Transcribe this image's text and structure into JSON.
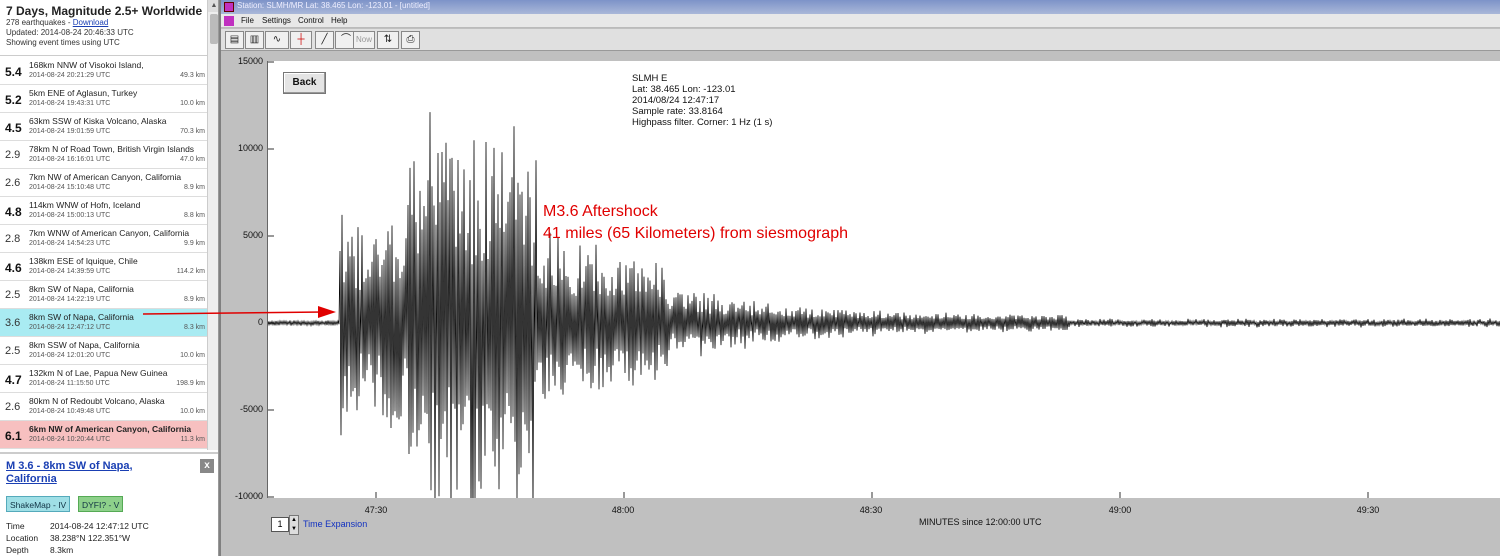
{
  "feed": {
    "title": "7 Days, Magnitude 2.5+ Worldwide",
    "count_text": "278 earthquakes - ",
    "download_label": "Download",
    "updated": "Updated: 2014-08-24 20:46:33 UTC",
    "showing": "Showing event times using UTC"
  },
  "quakes": [
    {
      "mag": "5.4",
      "place": "168km NNW of Visokoi Island,",
      "time": "2014-08-24 20:21:29 UTC",
      "depth": "49.3 km"
    },
    {
      "mag": "5.2",
      "place": "5km ENE of Aglasun, Turkey",
      "time": "2014-08-24 19:43:31 UTC",
      "depth": "10.0 km"
    },
    {
      "mag": "4.5",
      "place": "63km SSW of Kiska Volcano, Alaska",
      "time": "2014-08-24 19:01:59 UTC",
      "depth": "70.3 km"
    },
    {
      "mag": "2.9",
      "place": "78km N of Road Town, British Virgin Islands",
      "time": "2014-08-24 16:16:01 UTC",
      "depth": "47.0 km"
    },
    {
      "mag": "2.6",
      "place": "7km NW of American Canyon, California",
      "time": "2014-08-24 15:10:48 UTC",
      "depth": "8.9 km"
    },
    {
      "mag": "4.8",
      "place": "114km WNW of Hofn, Iceland",
      "time": "2014-08-24 15:00:13 UTC",
      "depth": "8.8 km"
    },
    {
      "mag": "2.8",
      "place": "7km WNW of American Canyon, California",
      "time": "2014-08-24 14:54:23 UTC",
      "depth": "9.9 km"
    },
    {
      "mag": "4.6",
      "place": "138km ESE of Iquique, Chile",
      "time": "2014-08-24 14:39:59 UTC",
      "depth": "114.2 km"
    },
    {
      "mag": "2.5",
      "place": "8km SW of Napa, California",
      "time": "2014-08-24 14:22:19 UTC",
      "depth": "8.9 km"
    },
    {
      "mag": "3.6",
      "place": "8km SW of Napa, California",
      "time": "2014-08-24 12:47:12 UTC",
      "depth": "8.3 km"
    },
    {
      "mag": "2.5",
      "place": "8km SSW of Napa, California",
      "time": "2014-08-24 12:01:20 UTC",
      "depth": "10.0 km"
    },
    {
      "mag": "4.7",
      "place": "132km N of Lae, Papua New Guinea",
      "time": "2014-08-24 11:15:50 UTC",
      "depth": "198.9 km"
    },
    {
      "mag": "2.6",
      "place": "80km N of Redoubt Volcano, Alaska",
      "time": "2014-08-24 10:49:48 UTC",
      "depth": "10.0 km"
    },
    {
      "mag": "6.1",
      "place": "6km NW of American Canyon, California",
      "time": "2014-08-24 10:20:44 UTC",
      "depth": "11.3 km"
    }
  ],
  "detail": {
    "title": "M 3.6 - 8km SW of Napa, California",
    "close": "x",
    "shakemap": "ShakeMap - IV",
    "dyfi": "DYFI? - V",
    "time_label": "Time",
    "time_value": "2014-08-24 12:47:12 UTC",
    "location_label": "Location",
    "location_value": "38.238°N 122.351°W",
    "depth_label": "Depth",
    "depth_value": "8.3km"
  },
  "window": {
    "title": "Station: SLMH/MR Lat: 38.465 Lon: -123.01 - [untitled]",
    "menu": [
      "File",
      "Settings",
      "Control",
      "Help"
    ],
    "now_label": "Now",
    "back_label": "Back"
  },
  "station_info": {
    "line1": "SLMH  E",
    "line2": "Lat: 38.465 Lon: -123.01",
    "line3": "2014/08/24 12:47:17",
    "line4": "Sample rate: 33.8164",
    "line5": "Highpass filter. Corner: 1 Hz (1 s)"
  },
  "annotation": {
    "line1": "M3.6 Aftershock",
    "line2": "41 miles (65 Kilometers) from siesmograph",
    "color": "#e00000"
  },
  "axes": {
    "y_ticks": [
      "15000",
      "10000",
      "5000",
      "0",
      "-5000",
      "-10000"
    ],
    "x_ticks": [
      "47:30",
      "48:00",
      "48:30",
      "49:00",
      "49:30"
    ],
    "xlabel": "MINUTES since 12:00:00 UTC",
    "time_expansion_value": "1",
    "time_expansion_label": "Time Expansion"
  },
  "colors": {
    "selected_row": "#a9ebf2",
    "highlight_row": "#f7c0c0",
    "trace": "#000000"
  }
}
